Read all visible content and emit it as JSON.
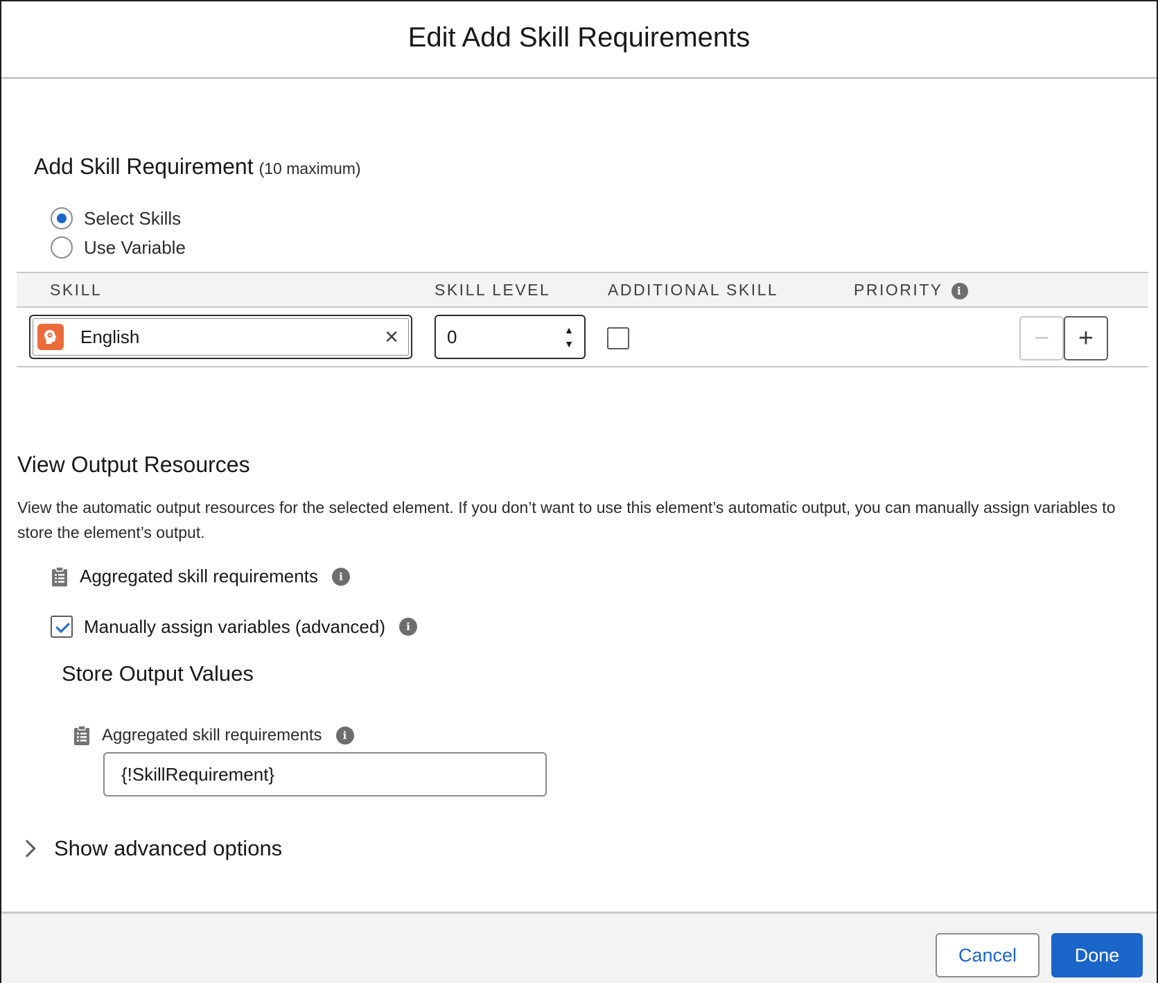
{
  "modal": {
    "title": "Edit Add Skill Requirements"
  },
  "skill_requirement": {
    "heading": "Add Skill Requirement",
    "heading_note": "(10 maximum)",
    "mode_options": [
      {
        "label": "Select Skills",
        "selected": true
      },
      {
        "label": "Use Variable",
        "selected": false
      }
    ],
    "columns": [
      "SKILL",
      "SKILL LEVEL",
      "ADDITIONAL SKILL",
      "PRIORITY"
    ],
    "rows": [
      {
        "skill": "English",
        "skill_level": "0",
        "additional_skill": false
      }
    ],
    "colors": {
      "skill_icon": "#ec6b3b"
    }
  },
  "output": {
    "heading": "View Output Resources",
    "description": "View the automatic output resources for the selected element. If you don’t want to use this element’s automatic output, you can manually assign variables to store the element’s output.",
    "resource_label": "Aggregated skill requirements",
    "manual_assign_label": "Manually assign variables (advanced)",
    "manual_assign_checked": true,
    "store_heading": "Store Output Values",
    "store_field_label": "Aggregated skill requirements",
    "store_field_value": "{!SkillRequirement}"
  },
  "advanced": {
    "toggle_label": "Show advanced options"
  },
  "footer": {
    "cancel_label": "Cancel",
    "done_label": "Done"
  },
  "theme": {
    "brand": "#1b66c9",
    "border": "#c9c9c9",
    "footer_bg": "#f3f3f3"
  }
}
